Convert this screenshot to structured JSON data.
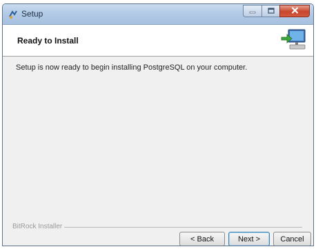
{
  "window": {
    "title": "Setup"
  },
  "header": {
    "title": "Ready to Install"
  },
  "content": {
    "message": "Setup is now ready to begin installing PostgreSQL on your computer."
  },
  "footer": {
    "brand": "BitRock Installer",
    "back_label": "< Back",
    "next_label": "Next >",
    "cancel_label": "Cancel"
  },
  "icons": {
    "app": "setup-app-icon",
    "header": "computer-install-icon",
    "minimize": "minimize-icon",
    "maximize": "maximize-icon",
    "close": "close-icon"
  },
  "colors": {
    "titlebar": "#b3cbe6",
    "close_button": "#c7452c",
    "dialog_background": "#f0f0f0",
    "default_button_border": "#3c7fb1"
  }
}
